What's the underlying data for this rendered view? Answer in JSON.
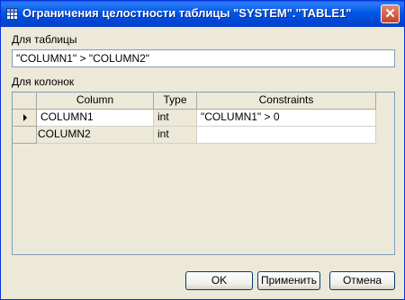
{
  "window": {
    "title": "Ограничения целостности таблицы \"SYSTEM\".\"TABLE1\""
  },
  "table_section": {
    "label": "Для таблицы",
    "expression": "\"COLUMN1\" > \"COLUMN2\""
  },
  "columns_section": {
    "label": "Для колонок",
    "headers": {
      "column": "Column",
      "type": "Type",
      "constraints": "Constraints"
    },
    "rows": [
      {
        "column": "COLUMN1",
        "type": "int",
        "constraints": "\"COLUMN1\" > 0",
        "current": true
      },
      {
        "column": "COLUMN2",
        "type": "int",
        "constraints": "",
        "current": false
      }
    ]
  },
  "buttons": {
    "ok": "OK",
    "apply": "Применить",
    "cancel": "Отмена"
  },
  "icons": {
    "window_icon": "table-icon",
    "close": "close-icon",
    "row_pointer": "row-pointer-icon"
  },
  "colors": {
    "titlebar": "#0058e6",
    "dialog_bg": "#ece9d8",
    "close_button": "#c4432a"
  }
}
